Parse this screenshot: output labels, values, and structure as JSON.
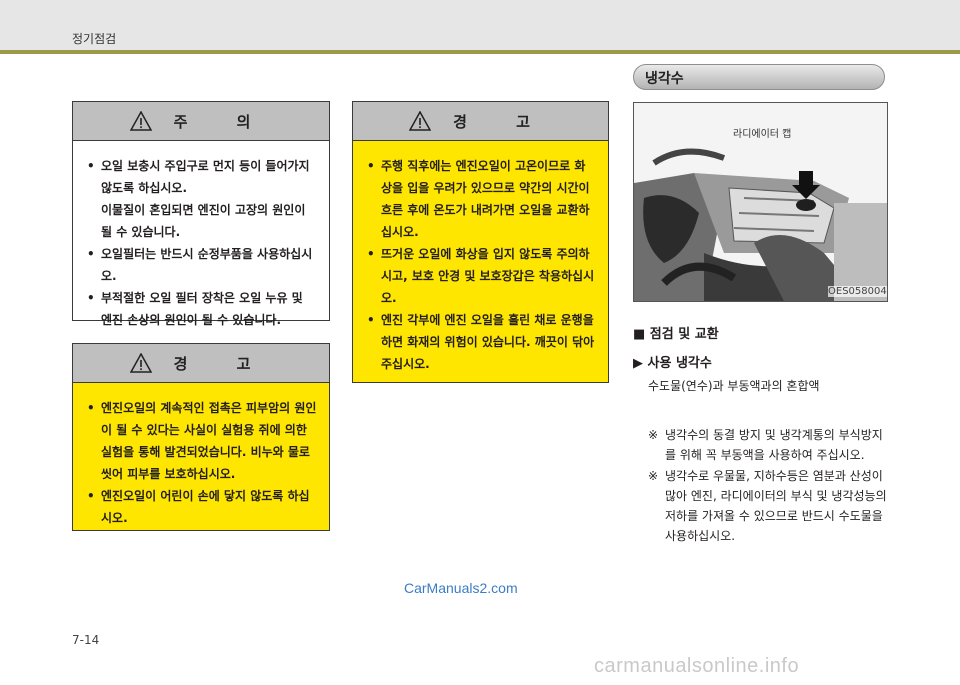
{
  "header": {
    "section": "정기점검"
  },
  "caution_box": {
    "title": "주 의",
    "items": [
      "오일 보충시 주입구로 먼지 등이 들어가지 않도록 하십시오.\n이물질이 혼입되면 엔진이 고장의 원인이 될 수 있습니다.",
      "오일필터는 반드시 순정부품을 사용하십시오.",
      "부적절한 오일 필터 장착은 오일 누유 및 엔진 손상의 원인이 될 수 있습니다."
    ]
  },
  "warning_box_left": {
    "title": "경 고",
    "items": [
      "엔진오일의 계속적인 접촉은 피부암의 원인이 될 수 있다는 사실이 실험용 쥐에 의한 실험을 통해 발견되었습니다. 비누와 물로 씻어 피부를 보호하십시오.",
      "엔진오일이 어린이 손에 닿지 않도록 하십시오."
    ]
  },
  "warning_box_mid": {
    "title": "경 고",
    "items": [
      "주행 직후에는 엔진오일이 고온이므로 화상을 입을 우려가 있으므로 약간의 시간이 흐른 후에 온도가 내려가면 오일을 교환하십시오.",
      "뜨거운 오일에 화상을 입지 않도록 주의하시고, 보호 안경 및 보호장갑은 착용하십시오.",
      "엔진 각부에 엔진 오일을 흘린 채로 운행을 하면 화재의 위험이 있습니다. 깨끗이 닦아 주십시오."
    ]
  },
  "coolant": {
    "title": "냉각수",
    "photo_caption": "라디에이터 캡",
    "photo_code": "OES058004",
    "inspect_heading": "■ 점검 및 교환",
    "use_heading": "▶ 사용 냉각수",
    "mix_text": "수도물(연수)과 부동액과의 혼합액",
    "notes": [
      {
        "mark": "※",
        "text": "냉각수의 동결 방지 및 냉각계통의 부식방지를 위해 꼭 부동액을 사용하여 주십시오."
      },
      {
        "mark": "※",
        "text": "냉각수로 우물물, 지하수등은 염분과 산성이 많아 엔진, 라디에이터의 부식 및 냉각성능의 저하를 가져올 수 있으므로 반드시 수도물을 사용하십시오."
      }
    ]
  },
  "watermark": "CarManuals2.com",
  "page_number": "7-14",
  "footer_site": "carmanualsonline.info",
  "colors": {
    "warning_yellow": "#ffe600",
    "header_rule": "#9a9a48",
    "watermark_blue": "#3b7dc4"
  }
}
